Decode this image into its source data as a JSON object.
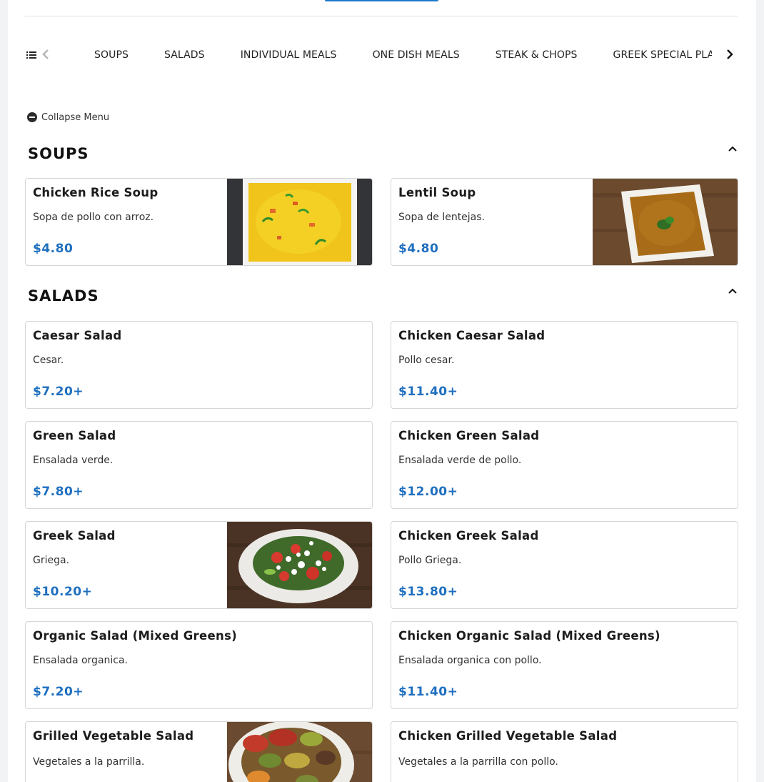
{
  "nav": {
    "categories": [
      "SOUPS",
      "SALADS",
      "INDIVIDUAL MEALS",
      "ONE DISH MEALS",
      "STEAK & CHOPS",
      "GREEK SPECIAL PLA"
    ]
  },
  "collapse_label": "Collapse Menu",
  "sections": [
    {
      "title": "SOUPS",
      "items": [
        {
          "name": "Chicken Rice Soup",
          "desc": "Sopa de pollo con arroz.",
          "price": "$4.80",
          "photo": "chicken-rice-soup-photo"
        },
        {
          "name": "Lentil Soup",
          "desc": "Sopa de lentejas.",
          "price": "$4.80",
          "photo": "lentil-soup-photo"
        }
      ]
    },
    {
      "title": "SALADS",
      "items": [
        {
          "name": "Caesar Salad",
          "desc": "Cesar.",
          "price": "$7.20+"
        },
        {
          "name": "Chicken Caesar Salad",
          "desc": "Pollo cesar.",
          "price": "$11.40+"
        },
        {
          "name": "Green Salad",
          "desc": "Ensalada verde.",
          "price": "$7.80+"
        },
        {
          "name": "Chicken Green Salad",
          "desc": "Ensalada verde de pollo.",
          "price": "$12.00+"
        },
        {
          "name": "Greek Salad",
          "desc": "Griega.",
          "price": "$10.20+",
          "photo": "greek-salad-photo"
        },
        {
          "name": "Chicken Greek Salad",
          "desc": "Pollo Griega.",
          "price": "$13.80+"
        },
        {
          "name": "Organic Salad (Mixed Greens)",
          "desc": "Ensalada organica.",
          "price": "$7.20+"
        },
        {
          "name": "Chicken Organic Salad (Mixed Greens)",
          "desc": "Ensalada organica con pollo.",
          "price": "$11.40+"
        },
        {
          "name": "Grilled Vegetable Salad",
          "desc": "Vegetales a la parrilla.",
          "photo": "grilled-vegetable-photo"
        },
        {
          "name": "Chicken Grilled Vegetable Salad",
          "desc": "Vegetales a la parrilla con pollo."
        }
      ]
    }
  ],
  "colors": {
    "accent": "#1f78c8",
    "price": "#1f6fbf"
  },
  "icons": [
    "list-icon",
    "chevron-left-icon",
    "chevron-right-icon",
    "minus-circle-icon",
    "chevron-up-icon"
  ]
}
